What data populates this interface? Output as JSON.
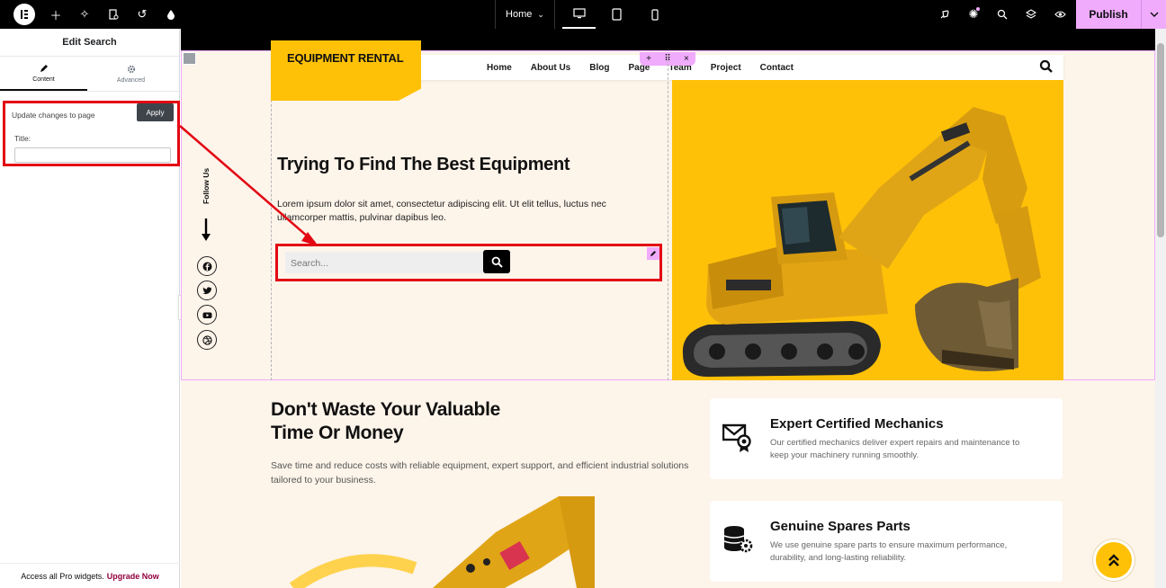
{
  "topbar": {
    "page_selector": "Home",
    "publish_label": "Publish",
    "icons": [
      "elementor-logo-icon",
      "add-icon",
      "ai-icon",
      "page-settings-icon",
      "history-icon",
      "site-settings-icon",
      "desktop-icon",
      "tablet-icon",
      "mobile-icon",
      "launchpad-icon",
      "notifications-icon",
      "search-icon",
      "structure-icon",
      "preview-icon",
      "chevron-down-icon"
    ]
  },
  "panel": {
    "title": "Edit Search",
    "tabs": [
      {
        "label": "Content"
      },
      {
        "label": "Advanced"
      }
    ],
    "update_text": "Update changes to page",
    "apply_label": "Apply",
    "title_label": "Title:",
    "title_value": "",
    "footer_text": "Access all Pro widgets.",
    "footer_link": "Upgrade Now"
  },
  "site": {
    "brand": "EQUIPMENT RENTAL",
    "nav": [
      "Home",
      "About Us",
      "Blog",
      "Page",
      "Team",
      "Project",
      "Contact"
    ],
    "follow_us": "Follow Us",
    "social": [
      "facebook-icon",
      "twitter-icon",
      "youtube-icon",
      "dribbble-icon"
    ],
    "hero_title": "Trying To Find The Best Equipment",
    "hero_text": "Lorem ipsum dolor sit amet, consectetur adipiscing elit. Ut elit tellus, luctus nec ullamcorper mattis, pulvinar dapibus leo.",
    "search_placeholder": "Search...",
    "section2_title_line1": "Don't Waste Your Valuable",
    "section2_title_line2": "Time Or Money",
    "section2_text": "Save time and reduce costs with reliable equipment, expert support, and efficient industrial solutions tailored to your business.",
    "cards": [
      {
        "title": "Expert Certified Mechanics",
        "text": "Our certified mechanics deliver expert repairs and maintenance to keep your machinery running smoothly.",
        "icon": "certified-mail-icon"
      },
      {
        "title": "Genuine Spares Parts",
        "text": "We use genuine spare parts to ensure maximum performance, durability, and long-lasting reliability.",
        "icon": "spare-parts-icon"
      }
    ]
  },
  "colors": {
    "accent": "#ffc107",
    "editor_pink": "#f0abfc",
    "highlight_red": "#e30613",
    "page_bg": "#fdf4ea"
  }
}
